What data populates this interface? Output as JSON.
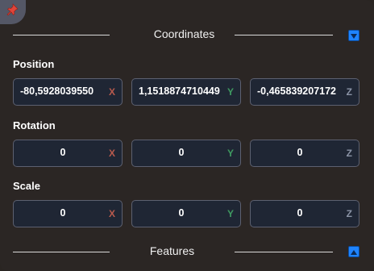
{
  "coordinates": {
    "title": "Coordinates",
    "position": {
      "label": "Position",
      "x": "-80,5928039550",
      "y": "1,1518874710449",
      "z": "-0,465839207172",
      "x_axis": "X",
      "y_axis": "Y",
      "z_axis": "Z"
    },
    "rotation": {
      "label": "Rotation",
      "x": "0",
      "y": "0",
      "z": "0",
      "x_axis": "X",
      "y_axis": "Y",
      "z_axis": "Z"
    },
    "scale": {
      "label": "Scale",
      "x": "0",
      "y": "0",
      "z": "0",
      "x_axis": "X",
      "y_axis": "Y",
      "z_axis": "Z"
    }
  },
  "features": {
    "title": "Features"
  },
  "icons": {
    "pin": "pushpin-icon",
    "collapse": "chevron-down-icon",
    "expand": "chevron-up-icon"
  },
  "colors": {
    "accent": "#1f84ff",
    "axis_x": "#b85a4d",
    "axis_y": "#3f9a61",
    "axis_z": "#8a93a5",
    "field_bg": "#1f2634",
    "panel_bg": "#2b2624"
  }
}
